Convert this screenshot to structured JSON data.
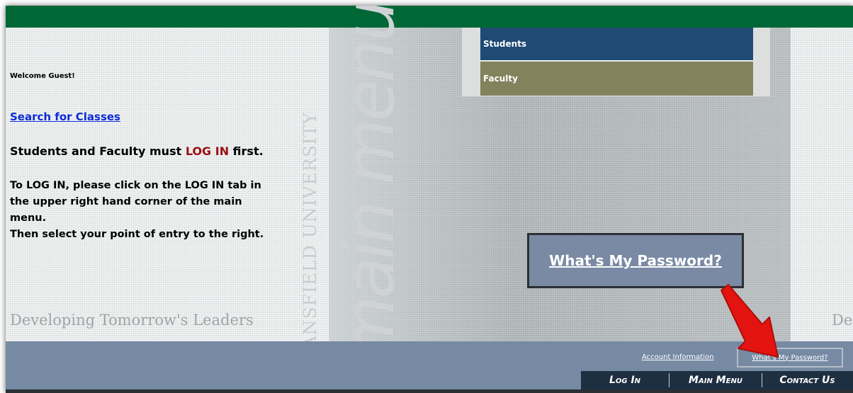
{
  "welcome_text": "Welcome Guest!",
  "search_link": "Search for Classes",
  "login_notice": {
    "before": "Students and Faculty must ",
    "highlight": "LOG IN",
    "after": " first."
  },
  "instructions": [
    "To LOG IN, please click on the LOG IN tab in",
    "the upper right hand corner of the main",
    "menu.",
    "Then select your point of entry to the right."
  ],
  "tagline": "Developing Tomorrow's Leaders",
  "tagline_partial": "De",
  "vertical_text": {
    "university": "MANSFIELD UNIVERSITY",
    "menu": "main menu"
  },
  "roles": [
    "Students",
    "Faculty"
  ],
  "password_box": "What's My Password?",
  "footer_links": {
    "account": "Account Information",
    "password": "What's My Password?"
  },
  "nav": [
    "Log In",
    "Main Menu",
    "Contact Us"
  ],
  "colors": {
    "top_bar": "#006837",
    "students": "#1e4a74",
    "faculty": "#82825c",
    "footer": "#768aa4",
    "nav_bar": "#1f2f42",
    "login_highlight": "#9a1010",
    "arrow": "#e3140f"
  },
  "icons": [
    "red-arrow-icon"
  ]
}
